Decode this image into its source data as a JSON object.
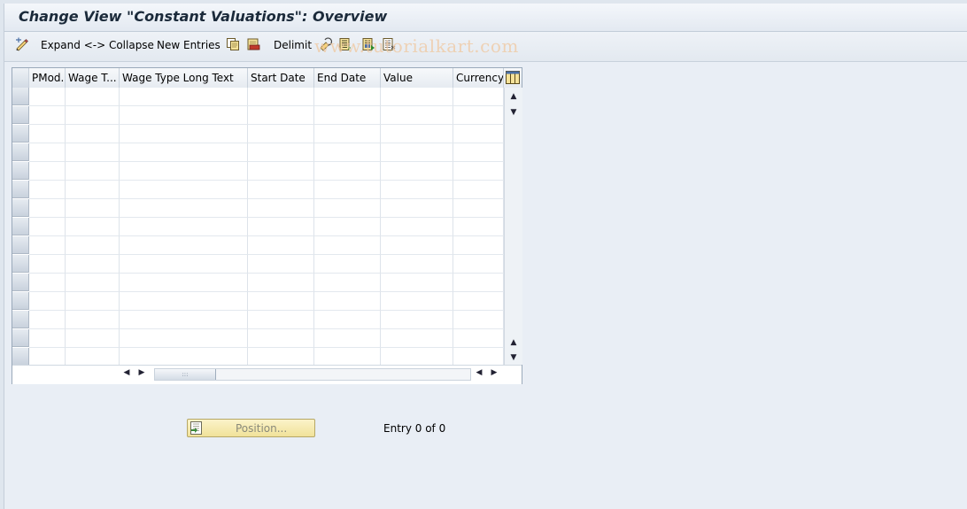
{
  "title": "Change View \"Constant Valuations\": Overview",
  "toolbar": {
    "expand_collapse": "Expand <-> Collapse",
    "new_entries": "New Entries",
    "delimit": "Delimit",
    "watermark": "www.tutorialkart.com"
  },
  "table": {
    "columns": [
      "PMod.",
      "Wage T...",
      "Wage Type Long Text",
      "Start Date",
      "End Date",
      "Value",
      "Currency"
    ],
    "rows": []
  },
  "position_button": "Position...",
  "entry_status": "Entry 0 of 0",
  "colors": {
    "background": "#e9eef5",
    "button_yellow": "#f1e29a"
  }
}
